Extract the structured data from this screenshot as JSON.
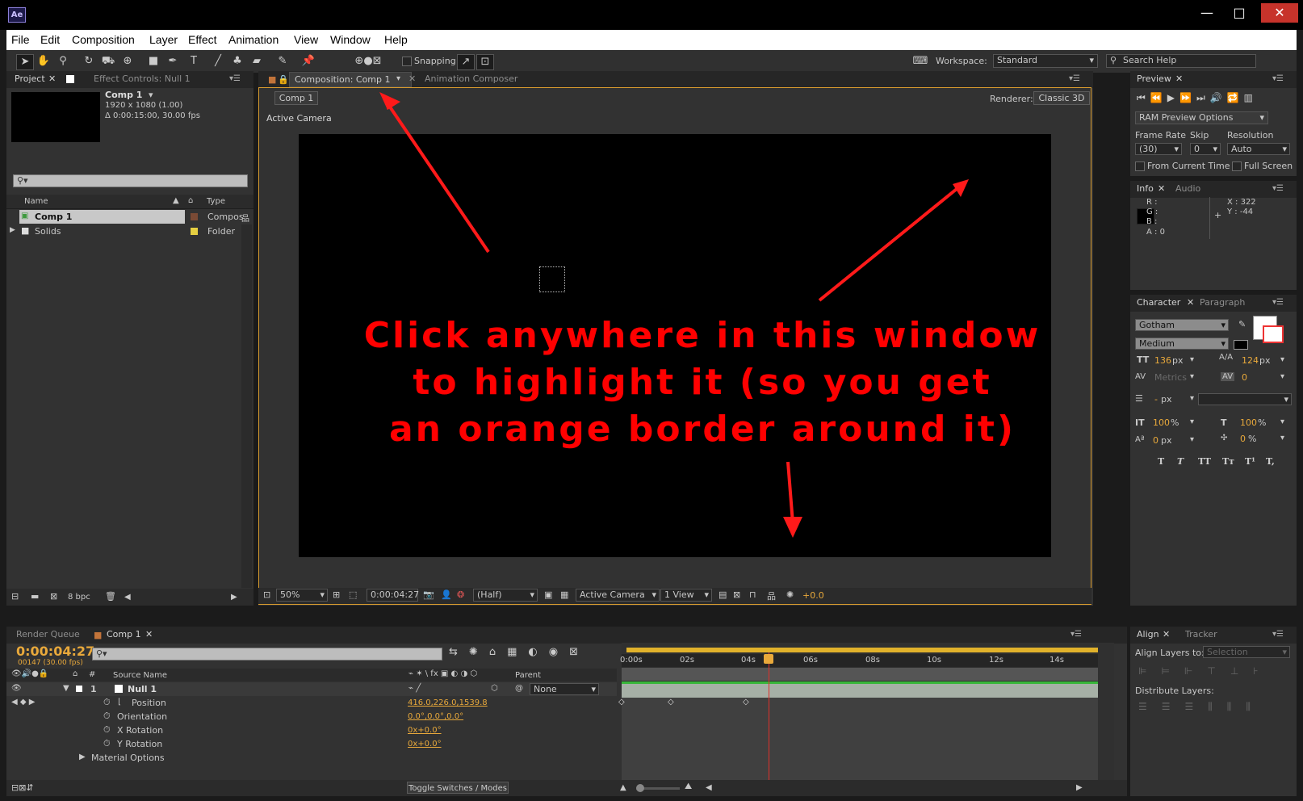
{
  "window": {
    "logo": "Ae",
    "minimize": "—",
    "maximize": "□",
    "close": "✕"
  },
  "menubar": {
    "items": [
      "File",
      "Edit",
      "Composition",
      "Layer",
      "Effect",
      "Animation",
      "View",
      "Window",
      "Help"
    ]
  },
  "toolbar": {
    "snapping_label": "Snapping",
    "workspace_label": "Workspace:",
    "workspace_value": "Standard",
    "search_placeholder": "Search Help"
  },
  "project_panel": {
    "tab_project": "Project",
    "tab_effect_controls": "Effect Controls: Null 1",
    "comp_name": "Comp 1",
    "comp_size": "1920 x 1080 (1.00)",
    "comp_duration": "Δ 0:00:15:00, 30.00 fps",
    "search_placeholder": "",
    "col_name": "Name",
    "col_type": "Type",
    "items": [
      {
        "name": "Comp 1",
        "type": "Compos",
        "color": "#7a4a35"
      },
      {
        "name": "Solids",
        "type": "Folder",
        "color": "#e5cf42"
      }
    ],
    "bpc": "8 bpc"
  },
  "composition_panel": {
    "tab_comp": "Composition: Comp 1",
    "tab_animation_composer": "Animation Composer",
    "breadcrumb": "Comp 1",
    "renderer_label": "Renderer:",
    "renderer_value": "Classic 3D",
    "camera_label": "Active Camera",
    "zoom": "50%",
    "timecode": "0:00:04:27",
    "resolution": "(Half)",
    "view_camera": "Active Camera",
    "view_count": "1 View",
    "exposure": "+0.0"
  },
  "annotation": {
    "line1": "Click anywhere in this window",
    "line2": "to highlight it (so you get",
    "line3": "an orange border around it)"
  },
  "preview_panel": {
    "tab": "Preview",
    "ram_options": "RAM Preview Options",
    "frame_rate_label": "Frame Rate",
    "skip_label": "Skip",
    "resolution_label": "Resolution",
    "frame_rate_value": "(30)",
    "skip_value": "0",
    "resolution_value": "Auto",
    "from_current_time": "From Current Time",
    "full_screen": "Full Screen"
  },
  "info_panel": {
    "tab_info": "Info",
    "tab_audio": "Audio",
    "r": "R :",
    "g": "G :",
    "b": "B :",
    "a": "A : 0",
    "x": "X : 322",
    "y": "Y : -44"
  },
  "character_panel": {
    "tab_character": "Character",
    "tab_paragraph": "Paragraph",
    "font": "Gotham",
    "style": "Medium",
    "size": "136",
    "size_unit": "px",
    "leading": "124",
    "leading_unit": "px",
    "kerning": "Metrics",
    "tracking": "0",
    "stroke": "-",
    "stroke_unit": "px",
    "vscale": "100",
    "vscale_unit": "%",
    "hscale": "100",
    "hscale_unit": "%",
    "baseline": "0",
    "baseline_unit": "px",
    "tsume": "0",
    "tsume_unit": "%",
    "styles": [
      "T",
      "T",
      "TT",
      "Tт",
      "T¹",
      "T,"
    ]
  },
  "timeline": {
    "tab_render_queue": "Render Queue",
    "tab_comp": "Comp 1",
    "timecode": "0:00:04:27",
    "frame_info": "00147 (30.00 fps)",
    "col_source_name": "Source Name",
    "col_parent": "Parent",
    "layer_number": "1",
    "layer_name": "Null 1",
    "parent_value": "None",
    "properties": [
      {
        "name": "Position",
        "value": "416.0,226.0,1539.8"
      },
      {
        "name": "Orientation",
        "value": "0.0°,0.0°,0.0°"
      },
      {
        "name": "X Rotation",
        "value": "0x+0.0°"
      },
      {
        "name": "Y Rotation",
        "value": "0x+0.0°"
      }
    ],
    "material_options": "Material Options",
    "toggle_label": "Toggle Switches / Modes",
    "ruler": [
      "0:00s",
      "02s",
      "04s",
      "06s",
      "08s",
      "10s",
      "12s",
      "14s"
    ]
  },
  "align_panel": {
    "tab_align": "Align",
    "tab_tracker": "Tracker",
    "align_layers_to": "Align Layers to:",
    "selection": "Selection",
    "distribute_layers": "Distribute Layers:"
  },
  "colors": {
    "accent_orange": "#e9a93b",
    "annotation_red": "#ff0000",
    "timeline_green": "#38b63a",
    "playhead": "#e0302a"
  }
}
